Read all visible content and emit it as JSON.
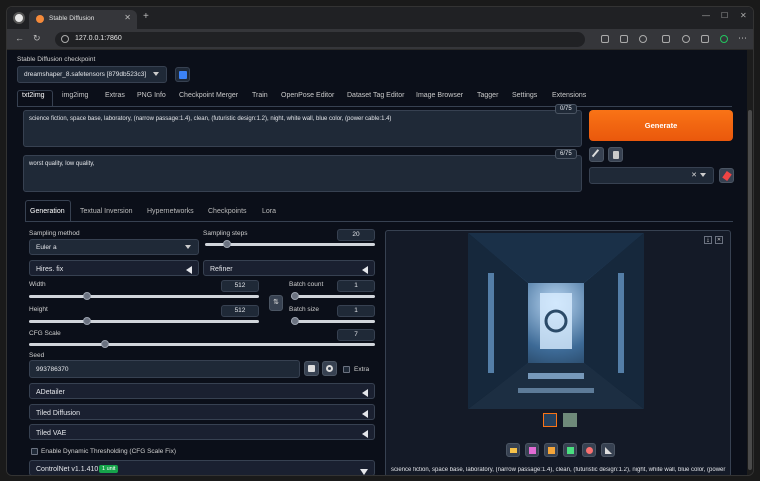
{
  "browser": {
    "tab_title": "Stable Diffusion",
    "url": "127.0.0.1:7860",
    "tab_close": "✕",
    "new_tab": "+",
    "minimize": "—",
    "maximize": "☐",
    "close": "✕"
  },
  "checkpoint": {
    "label": "Stable Diffusion checkpoint",
    "value": "dreamshaper_8.safetensors [879db523c3]"
  },
  "main_tabs": [
    "txt2img",
    "img2img",
    "Extras",
    "PNG Info",
    "Checkpoint Merger",
    "Train",
    "OpenPose Editor",
    "Dataset Tag Editor",
    "Image Browser",
    "Tagger",
    "Settings",
    "Extensions"
  ],
  "prompt": {
    "positive": "science fiction, space base, laboratory,  (narrow passage:1.4), clean, (futuristic design:1.2), night,  white wall, blue color, (power cable:1.4)",
    "positive_counter": "0/75",
    "negative": "worst quality, low quality,",
    "negative_counter": "6/75"
  },
  "generate_label": "Generate",
  "style_clear": "✕",
  "sub_tabs": [
    "Generation",
    "Textual Inversion",
    "Hypernetworks",
    "Checkpoints",
    "Lora"
  ],
  "generation": {
    "sampling_method_label": "Sampling method",
    "sampling_method": "Euler a",
    "sampling_steps_label": "Sampling steps",
    "sampling_steps": "20",
    "sampling_steps_fraction": 0.13,
    "hires_fix": "Hires. fix",
    "refiner": "Refiner",
    "width_label": "Width",
    "width": "512",
    "width_fraction": 0.25,
    "height_label": "Height",
    "height": "512",
    "height_fraction": 0.25,
    "batch_count_label": "Batch count",
    "batch_count": "1",
    "batch_size_label": "Batch size",
    "batch_size": "1",
    "cfg_label": "CFG Scale",
    "cfg": "7",
    "cfg_fraction": 0.22,
    "seed_label": "Seed",
    "seed": "993786370",
    "extra_label": "Extra",
    "swap_icon": "⇅"
  },
  "accordions": {
    "adetailer": "ADetailer",
    "tiled_diffusion": "Tiled Diffusion",
    "tiled_vae": "Tiled VAE",
    "dynamic_thresholding": "Enable Dynamic Thresholding (CFG Scale Fix)",
    "controlnet": "ControlNet v1.1.410",
    "controlnet_badge": "1 unit"
  },
  "gallery": {
    "caption": "science fiction, space base, laboratory, (narrow passage:1.4), clean, (futuristic design:1.2), night, white wall, blue color, (power",
    "close_1": "⤓",
    "close_2": "✕"
  },
  "colors": {
    "accent": "#f97316",
    "page_bg": "#0b0f19",
    "panel": "#1f2937",
    "badge": "#16a34a"
  }
}
